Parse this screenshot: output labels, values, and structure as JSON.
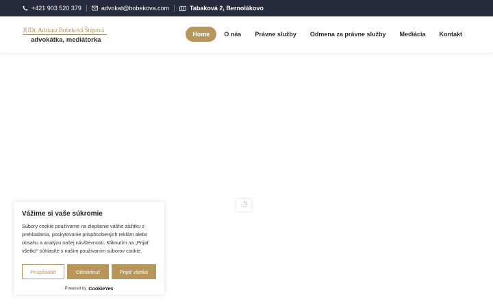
{
  "topbar": {
    "phone": "+421 903 520 379",
    "email": "advokat@bobekova.com",
    "address": "Tabaková 2, Bernolákovo"
  },
  "logo": {
    "line1": "JUDr. Adriana Bobeková Štepová",
    "line2": "advokátka, mediátorka"
  },
  "nav": {
    "items": [
      {
        "label": "Home"
      },
      {
        "label": "O nás"
      },
      {
        "label": "Právne služby"
      },
      {
        "label": "Odmena za právne služby"
      },
      {
        "label": "Mediácia"
      },
      {
        "label": "Kontakt"
      }
    ],
    "active_index": 0
  },
  "cookie": {
    "title": "Vážime si vaše súkromie",
    "text": "Súbory cookie používame na zlepšenie vášho zážitku z prehliadania, poskytovanie prispôsobených reklám alebo obsahu a analýzu našej návštevnosti. Kliknutím na „Prijať všetko“ súhlasíte s naším používaním súborov cookie.",
    "customize_label": "Prispôsobiť",
    "reject_label": "Odmietnuť",
    "accept_label": "Prijať všetko",
    "powered_by": "Powered by",
    "brand": "CookieYes"
  },
  "colors": {
    "topbar_bg": "#262b3d",
    "accent": "#b7965c"
  },
  "icons": {
    "phone": "phone-icon",
    "email": "envelope-icon",
    "address": "map-icon",
    "loading": "spinner-icon"
  }
}
